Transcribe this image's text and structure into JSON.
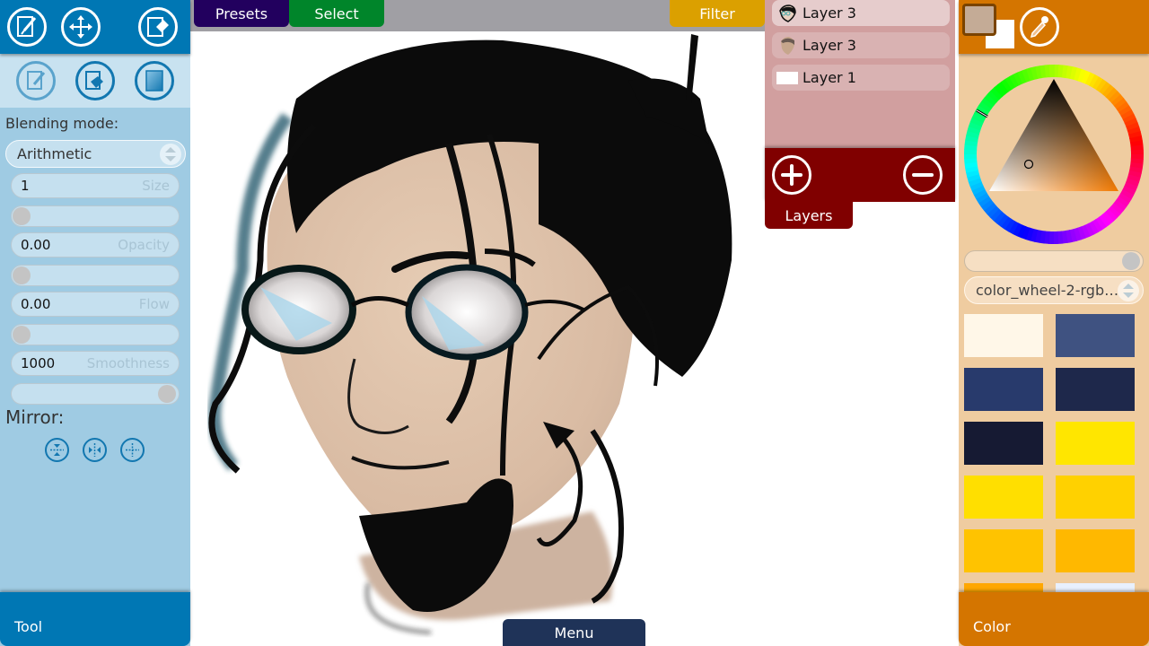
{
  "top_tabs": {
    "presets": "Presets",
    "select": "Select",
    "filter": "Filter"
  },
  "tool_panel": {
    "title": "Tool",
    "top_icons": [
      "brush-tool-icon",
      "move-tool-icon",
      "eraser-tool-icon"
    ],
    "sub_icons": [
      "paint-mode-icon",
      "fill-bucket-icon",
      "gradient-icon"
    ],
    "blending_label": "Blending mode:",
    "blending_value": "Arithmetic",
    "size": {
      "value": "1",
      "label": "Size",
      "slider": 0.0
    },
    "opacity": {
      "value": "0.00",
      "label": "Opacity",
      "slider": 0.0
    },
    "flow": {
      "value": "0.00",
      "label": "Flow",
      "slider": 0.0
    },
    "smoothness": {
      "value": "1000",
      "label": "Smoothness",
      "slider": 1.0
    },
    "mirror_label": "Mirror:",
    "mirror_icons": [
      "mirror-vertical-icon",
      "mirror-horizontal-icon",
      "mirror-both-icon"
    ]
  },
  "layers": {
    "title": "Layers",
    "items": [
      {
        "name": "Layer 3",
        "active": true,
        "thumb": "line-art-thumb"
      },
      {
        "name": "Layer 3",
        "active": false,
        "thumb": "color-thumb"
      },
      {
        "name": "Layer 1",
        "active": false,
        "thumb": "white-thumb"
      }
    ],
    "add_icon": "add-layer-icon",
    "remove_icon": "remove-layer-icon"
  },
  "color_panel": {
    "title": "Color",
    "primary_color": "#c4ab96",
    "secondary_color": "#ffffff",
    "palette_name": "color_wheel-2-rgb…",
    "alpha_slider": 1.0,
    "hue_degrees": 25,
    "palette": [
      "#fff7e8",
      "#3f5281",
      "#283a6c",
      "#1e284b",
      "#161a33",
      "#ffe600",
      "#ffdf00",
      "#ffd100",
      "#ffc300",
      "#ffb800",
      "#ffa700",
      "#e8f0ff"
    ]
  },
  "menu": {
    "label": "Menu"
  },
  "colors": {
    "tool_accent": "#0077b4",
    "layers_accent": "#800000",
    "color_accent": "#d47500",
    "menu": "#1f3358"
  }
}
